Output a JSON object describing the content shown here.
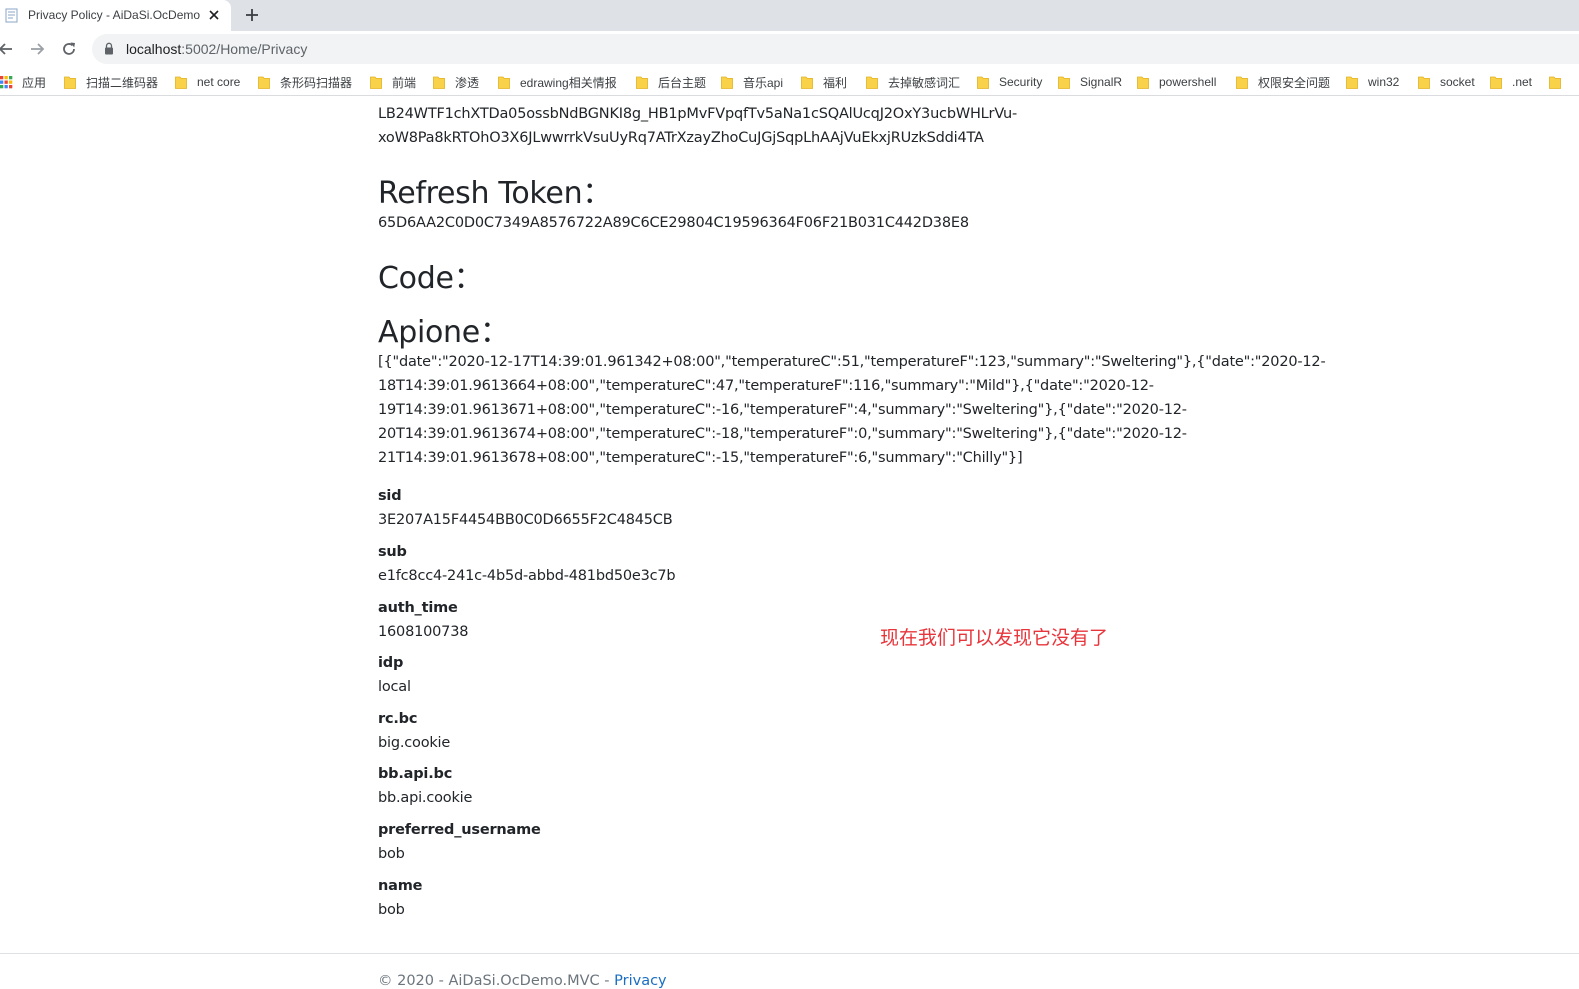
{
  "browser": {
    "tab_title": "Privacy Policy - AiDaSi.OcDemo.M",
    "url_host": "localhost",
    "url_rest": ":5002/Home/Privacy"
  },
  "bookmarks": [
    {
      "label": "应用",
      "icon": "apps-grid-icon"
    },
    {
      "label": "扫描二维码器",
      "icon": "folder-icon"
    },
    {
      "label": "net core",
      "icon": "folder-icon"
    },
    {
      "label": "条形码扫描器",
      "icon": "folder-icon"
    },
    {
      "label": "前端",
      "icon": "folder-icon"
    },
    {
      "label": "渗透",
      "icon": "folder-icon"
    },
    {
      "label": "edrawing相关情报",
      "icon": "folder-icon"
    },
    {
      "label": "后台主题",
      "icon": "folder-icon"
    },
    {
      "label": "音乐api",
      "icon": "folder-icon"
    },
    {
      "label": "福利",
      "icon": "folder-icon"
    },
    {
      "label": "去掉敏感词汇",
      "icon": "folder-icon"
    },
    {
      "label": "Security",
      "icon": "folder-icon"
    },
    {
      "label": "SignalR",
      "icon": "folder-icon"
    },
    {
      "label": "powershell",
      "icon": "folder-icon"
    },
    {
      "label": "权限安全问题",
      "icon": "folder-icon"
    },
    {
      "label": "win32",
      "icon": "folder-icon"
    },
    {
      "label": "socket",
      "icon": "folder-icon"
    },
    {
      "label": ".net",
      "icon": "folder-icon"
    }
  ],
  "page": {
    "access_token_tail": [
      "LB24WTF1chXTDa05ossbNdBGNKI8g_HB1pMvFVpqfTv5aNa1cSQAlUcqJ2OxY3ucbWHLrVu-",
      "xoW8Pa8kRTOhO3X6JLwwrrkVsuUyRq7ATrXzayZhoCuJGjSqpLhAAjVuEkxjRUzkSddi4TA"
    ],
    "refresh_heading": "Refresh Token：",
    "refresh_value": "65D6AA2C0D0C7349A8576722A89C6CE29804C19596364F06F21B031C442D38E8",
    "code_heading": "Code：",
    "apione_heading": "Apione：",
    "apione_lines": [
      "[{\"date\":\"2020-12-17T14:39:01.961342+08:00\",\"temperatureC\":51,\"temperatureF\":123,\"summary\":\"Sweltering\"},{\"date\":\"2020-12-",
      "18T14:39:01.9613664+08:00\",\"temperatureC\":47,\"temperatureF\":116,\"summary\":\"Mild\"},{\"date\":\"2020-12-",
      "19T14:39:01.9613671+08:00\",\"temperatureC\":-16,\"temperatureF\":4,\"summary\":\"Sweltering\"},{\"date\":\"2020-12-",
      "20T14:39:01.9613674+08:00\",\"temperatureC\":-18,\"temperatureF\":0,\"summary\":\"Sweltering\"},{\"date\":\"2020-12-",
      "21T14:39:01.9613678+08:00\",\"temperatureC\":-15,\"temperatureF\":6,\"summary\":\"Chilly\"}]"
    ],
    "claims": [
      {
        "key": "sid",
        "value": "3E207A15F4454BB0C0D6655F2C4845CB"
      },
      {
        "key": "sub",
        "value": "e1fc8cc4-241c-4b5d-abbd-481bd50e3c7b"
      },
      {
        "key": "auth_time",
        "value": "1608100738"
      },
      {
        "key": "idp",
        "value": "local"
      },
      {
        "key": "rc.bc",
        "value": "big.cookie"
      },
      {
        "key": "bb.api.bc",
        "value": "bb.api.cookie"
      },
      {
        "key": "preferred_username",
        "value": "bob"
      },
      {
        "key": "name",
        "value": "bob"
      }
    ],
    "annotation": "现在我们可以发现它没有了"
  },
  "footer": {
    "copyright": "© 2020 - AiDaSi.OcDemo.MVC - ",
    "privacy_link": "Privacy"
  },
  "colors": {
    "annotation": "#e8353b",
    "link": "#1b6ec2"
  }
}
